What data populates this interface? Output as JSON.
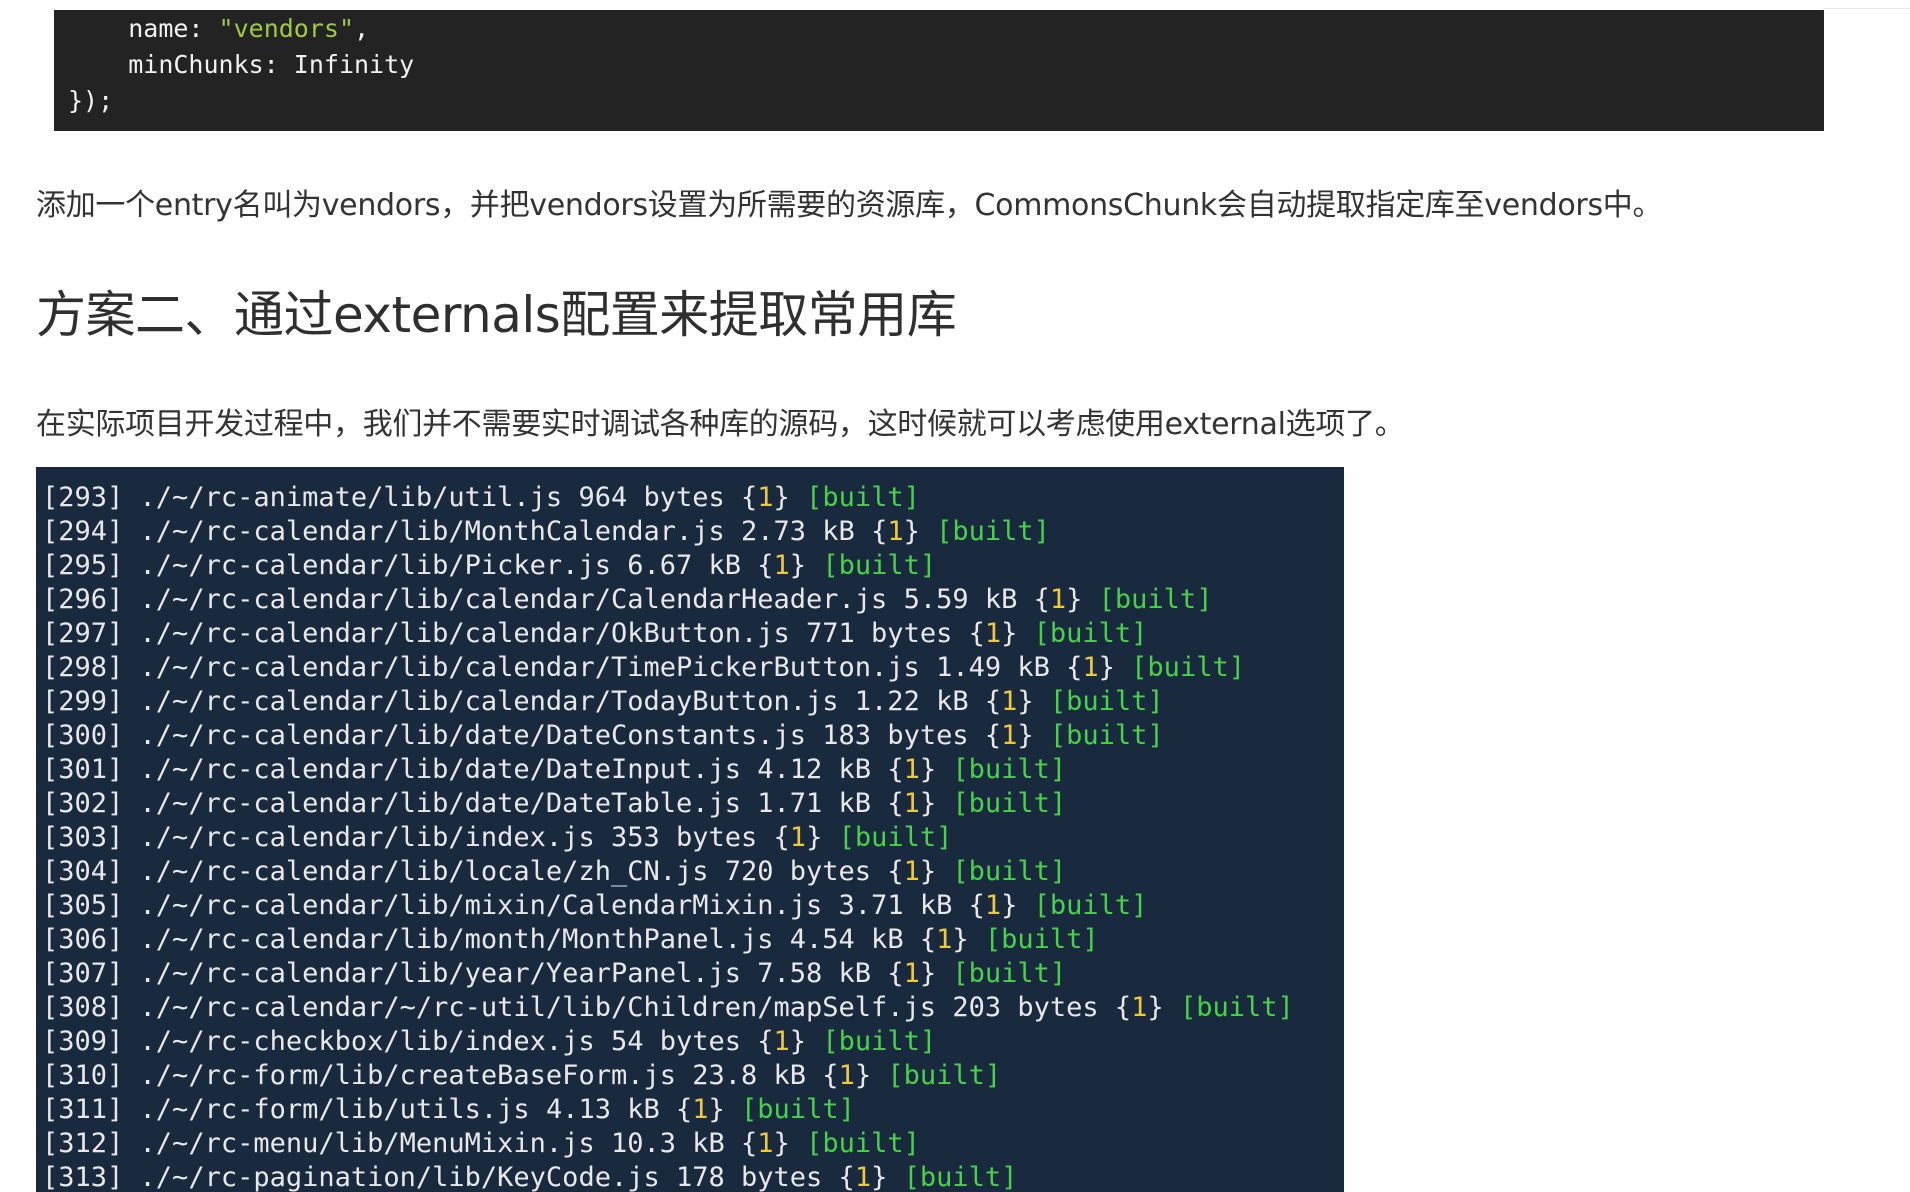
{
  "code_block": {
    "lines": [
      {
        "indent": "    ",
        "key": "name:",
        "string": "\"vendors\"",
        "tail": ","
      },
      {
        "indent": "    ",
        "key": "minChunks:",
        "value": "Infinity"
      },
      {
        "text": "});"
      }
    ]
  },
  "paragraph_1": "添加一个entry名叫为vendors，并把vendors设置为所需要的资源库，CommonsChunk会自动提取指定库至vendors中。",
  "heading": "方案二、通过externals配置来提取常用库",
  "paragraph_2": "在实际项目开发过程中，我们并不需要实时调试各种库的源码，这时候就可以考虑使用external选项了。",
  "terminal": {
    "colors": {
      "background": "#192a3e",
      "text": "#e8e8e8",
      "chunk": "#f0c83a",
      "built": "#47d247"
    },
    "rows": [
      {
        "id": "[293]",
        "path": "./~/rc-animate/lib/util.js",
        "size": "964 bytes",
        "chunk": "1",
        "status": "[built]"
      },
      {
        "id": "[294]",
        "path": "./~/rc-calendar/lib/MonthCalendar.js",
        "size": "2.73 kB",
        "chunk": "1",
        "status": "[built]"
      },
      {
        "id": "[295]",
        "path": "./~/rc-calendar/lib/Picker.js",
        "size": "6.67 kB",
        "chunk": "1",
        "status": "[built]"
      },
      {
        "id": "[296]",
        "path": "./~/rc-calendar/lib/calendar/CalendarHeader.js",
        "size": "5.59 kB",
        "chunk": "1",
        "status": "[built]"
      },
      {
        "id": "[297]",
        "path": "./~/rc-calendar/lib/calendar/OkButton.js",
        "size": "771 bytes",
        "chunk": "1",
        "status": "[built]"
      },
      {
        "id": "[298]",
        "path": "./~/rc-calendar/lib/calendar/TimePickerButton.js",
        "size": "1.49 kB",
        "chunk": "1",
        "status": "[built]"
      },
      {
        "id": "[299]",
        "path": "./~/rc-calendar/lib/calendar/TodayButton.js",
        "size": "1.22 kB",
        "chunk": "1",
        "status": "[built]"
      },
      {
        "id": "[300]",
        "path": "./~/rc-calendar/lib/date/DateConstants.js",
        "size": "183 bytes",
        "chunk": "1",
        "status": "[built]"
      },
      {
        "id": "[301]",
        "path": "./~/rc-calendar/lib/date/DateInput.js",
        "size": "4.12 kB",
        "chunk": "1",
        "status": "[built]"
      },
      {
        "id": "[302]",
        "path": "./~/rc-calendar/lib/date/DateTable.js",
        "size": "1.71 kB",
        "chunk": "1",
        "status": "[built]"
      },
      {
        "id": "[303]",
        "path": "./~/rc-calendar/lib/index.js",
        "size": "353 bytes",
        "chunk": "1",
        "status": "[built]"
      },
      {
        "id": "[304]",
        "path": "./~/rc-calendar/lib/locale/zh_CN.js",
        "size": "720 bytes",
        "chunk": "1",
        "status": "[built]"
      },
      {
        "id": "[305]",
        "path": "./~/rc-calendar/lib/mixin/CalendarMixin.js",
        "size": "3.71 kB",
        "chunk": "1",
        "status": "[built]"
      },
      {
        "id": "[306]",
        "path": "./~/rc-calendar/lib/month/MonthPanel.js",
        "size": "4.54 kB",
        "chunk": "1",
        "status": "[built]"
      },
      {
        "id": "[307]",
        "path": "./~/rc-calendar/lib/year/YearPanel.js",
        "size": "7.58 kB",
        "chunk": "1",
        "status": "[built]"
      },
      {
        "id": "[308]",
        "path": "./~/rc-calendar/~/rc-util/lib/Children/mapSelf.js",
        "size": "203 bytes",
        "chunk": "1",
        "status": "[built]"
      },
      {
        "id": "[309]",
        "path": "./~/rc-checkbox/lib/index.js",
        "size": "54 bytes",
        "chunk": "1",
        "status": "[built]"
      },
      {
        "id": "[310]",
        "path": "./~/rc-form/lib/createBaseForm.js",
        "size": "23.8 kB",
        "chunk": "1",
        "status": "[built]"
      },
      {
        "id": "[311]",
        "path": "./~/rc-form/lib/utils.js",
        "size": "4.13 kB",
        "chunk": "1",
        "status": "[built]"
      },
      {
        "id": "[312]",
        "path": "./~/rc-menu/lib/MenuMixin.js",
        "size": "10.3 kB",
        "chunk": "1",
        "status": "[built]"
      },
      {
        "id": "[313]",
        "path": "./~/rc-pagination/lib/KeyCode.js",
        "size": "178 bytes",
        "chunk": "1",
        "status": "[built]"
      }
    ]
  }
}
